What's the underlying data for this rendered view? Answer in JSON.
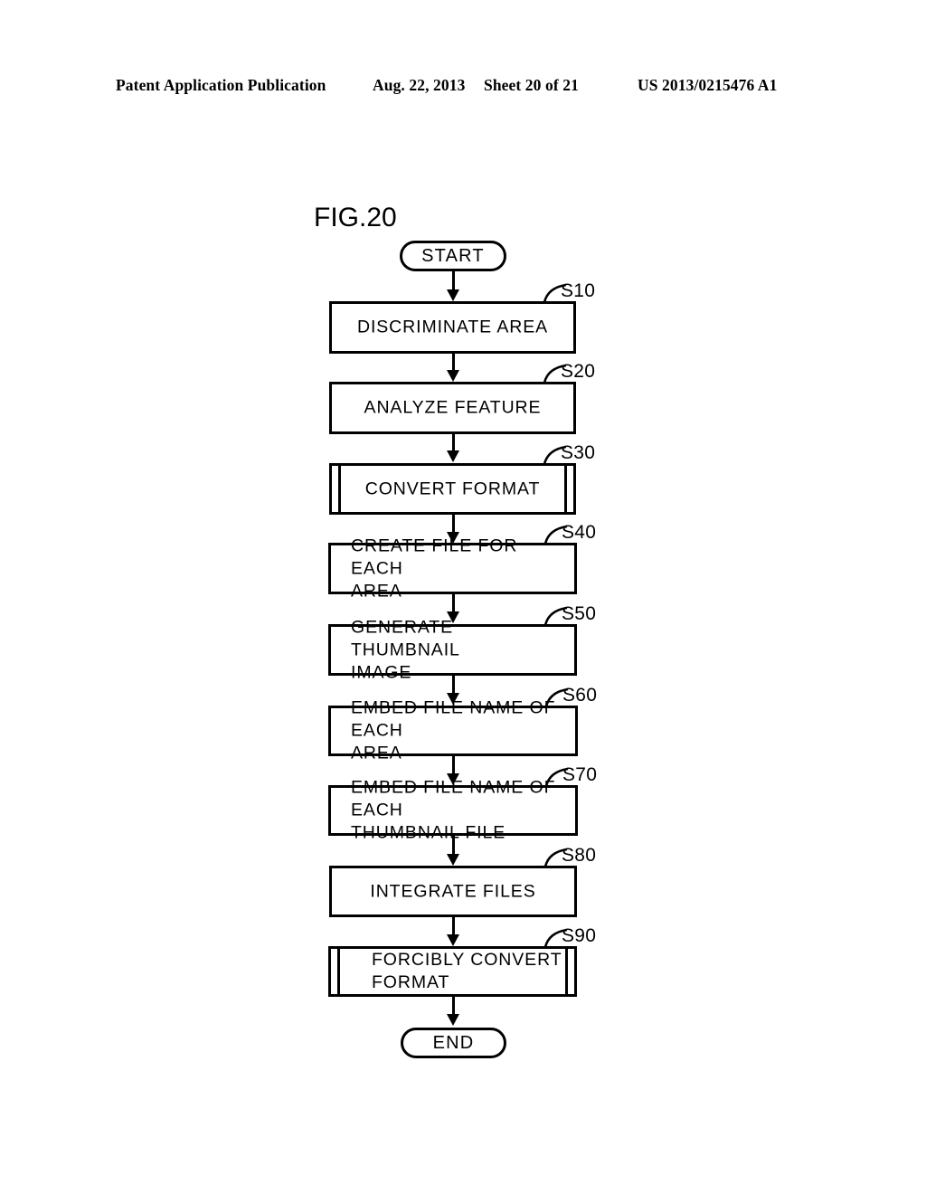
{
  "header": {
    "publication": "Patent Application Publication",
    "date": "Aug. 22, 2013",
    "sheet": "Sheet 20 of 21",
    "number": "US 2013/0215476 A1"
  },
  "figure": {
    "title": "FIG.20",
    "start_label": "START",
    "end_label": "END",
    "steps": [
      {
        "id": "S10",
        "label": "DISCRIMINATE AREA",
        "shape": "process",
        "align": "center"
      },
      {
        "id": "S20",
        "label": "ANALYZE FEATURE",
        "shape": "process",
        "align": "center"
      },
      {
        "id": "S30",
        "label": "CONVERT FORMAT",
        "shape": "predefined",
        "align": "center"
      },
      {
        "id": "S40",
        "label": "CREATE FILE FOR EACH\nAREA",
        "shape": "process",
        "align": "left"
      },
      {
        "id": "S50",
        "label": "GENERATE THUMBNAIL\nIMAGE",
        "shape": "process",
        "align": "left"
      },
      {
        "id": "S60",
        "label": "EMBED FILE NAME OF EACH\nAREA",
        "shape": "process",
        "align": "left"
      },
      {
        "id": "S70",
        "label": "EMBED FILE NAME OF EACH\nTHUMBNAIL FILE",
        "shape": "process",
        "align": "left"
      },
      {
        "id": "S80",
        "label": "INTEGRATE FILES",
        "shape": "process",
        "align": "center"
      },
      {
        "id": "S90",
        "label": "FORCIBLY CONVERT\nFORMAT",
        "shape": "predefined",
        "align": "indent"
      }
    ]
  },
  "colors": {
    "ink": "#000000",
    "paper": "#ffffff"
  }
}
